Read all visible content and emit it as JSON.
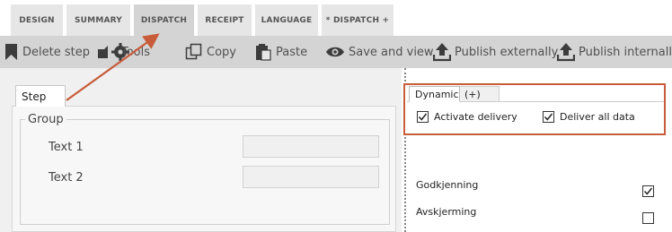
{
  "tabs": [
    {
      "label": "DESIGN"
    },
    {
      "label": "SUMMARY"
    },
    {
      "label": "DISPATCH"
    },
    {
      "label": "RECEIPT"
    },
    {
      "label": "LANGUAGE"
    },
    {
      "label": "* DISPATCH +"
    }
  ],
  "active_tab": "DISPATCH",
  "toolbar": {
    "delete_step": "Delete step",
    "tools": "Tools",
    "copy": "Copy",
    "paste": "Paste",
    "save_and_view": "Save and view",
    "publish_externally": "Publish externally",
    "publish_internally": "Publish internally"
  },
  "step_editor": {
    "tab_label": "Step",
    "group_label": "Group",
    "fields": [
      {
        "label": "Text 1",
        "value": ""
      },
      {
        "label": "Text 2",
        "value": ""
      }
    ]
  },
  "dispatch_panel": {
    "tabs": [
      {
        "label": "Dynamic"
      },
      {
        "label": "(+)"
      }
    ],
    "activate_delivery": {
      "label": "Activate delivery",
      "checked": true
    },
    "deliver_all_data": {
      "label": "Deliver all data",
      "checked": true
    }
  },
  "properties": [
    {
      "label": "Godkjenning",
      "checked": true
    },
    {
      "label": "Avskjerming",
      "checked": false
    }
  ],
  "colors": {
    "annotation": "#c75c3a",
    "toolbar_bg": "#d4d4d4",
    "tab_bg": "#e6e6e6"
  }
}
